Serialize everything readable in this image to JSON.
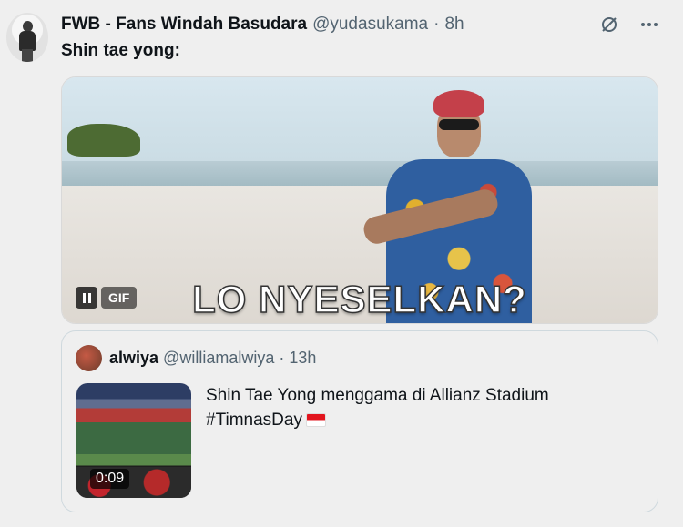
{
  "tweet": {
    "display_name": "FWB - Fans Windah Basudara",
    "handle": "@yudasukama",
    "separator": "·",
    "time": "8h",
    "text": "Shin tae yong:"
  },
  "media": {
    "type": "gif",
    "badge": "GIF",
    "caption": "LO NYESELKAN?"
  },
  "quoted_tweet": {
    "display_name": "alwiya",
    "handle": "@williamalwiya",
    "separator": "·",
    "time": "13h",
    "line1": "Shin Tae Yong menggama di Allianz Stadium",
    "line2": "#TimnasDay",
    "video_duration": "0:09"
  },
  "icons": [
    "grok-icon",
    "more-icon",
    "pause-icon",
    "indonesia-flag-icon"
  ]
}
